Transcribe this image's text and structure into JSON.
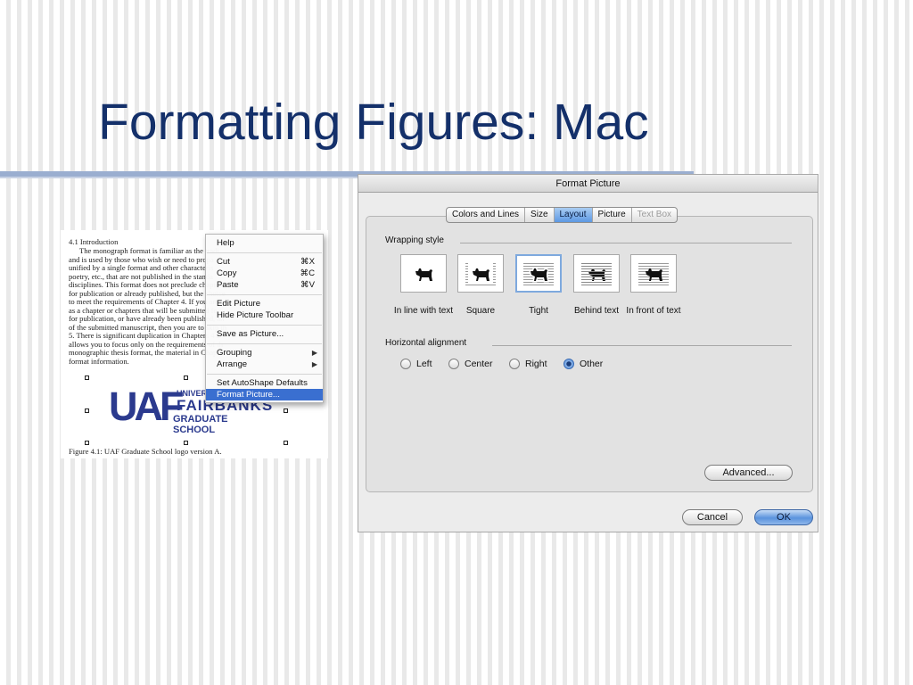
{
  "slide": {
    "title": "Formatting Figures: Mac"
  },
  "document": {
    "heading": "4.1    Introduction",
    "lines": [
      {
        "text": "The monograph format is familiar as the tradi",
        "indent": true
      },
      {
        "text": "and is used by those who wish or need to propa",
        "indent": false
      },
      {
        "text": "unified by a single format and other characteris",
        "indent": false
      },
      {
        "text": "poetry, etc., that are not published in the standa",
        "indent": false
      },
      {
        "text": "disciplines. This format does not preclude chapters",
        "indent": false
      },
      {
        "text": "for publication or already published, but the choice",
        "indent": false
      },
      {
        "text": "to meet the requirements of Chapter 4. If you are",
        "indent": false
      },
      {
        "text": "as a chapter or chapters that will be submitted fo",
        "indent": false
      },
      {
        "text": "for publication, or have already been published, an",
        "indent": false
      },
      {
        "text": "of the submitted manuscript, then you are to skip th",
        "indent": false
      },
      {
        "text": "5. There is significant duplication in Chapters 4 a",
        "indent": false
      },
      {
        "text": "allows you to focus only on the requirements of th",
        "indent": false
      },
      {
        "text": "monographic thesis format, the material in Chapter",
        "indent": false
      },
      {
        "text": "format information.",
        "indent": false
      }
    ],
    "logo": {
      "uaf": "UAF",
      "university": "UNIVERSITY",
      "fairbanks": "FAIRBANKS",
      "graduate_school": "GRADUATE SCHOOL"
    },
    "caption": "Figure 4.1: UAF Graduate School logo version A."
  },
  "context_menu": {
    "items": [
      {
        "label": "Help",
        "shortcut": "",
        "submenu": false
      },
      {
        "label": "Cut",
        "shortcut": "⌘X",
        "submenu": false
      },
      {
        "label": "Copy",
        "shortcut": "⌘C",
        "submenu": false
      },
      {
        "label": "Paste",
        "shortcut": "⌘V",
        "submenu": false
      },
      {
        "label": "Edit Picture",
        "shortcut": "",
        "submenu": false
      },
      {
        "label": "Hide Picture Toolbar",
        "shortcut": "",
        "submenu": false
      },
      {
        "label": "Save as Picture...",
        "shortcut": "",
        "submenu": false
      },
      {
        "label": "Grouping",
        "shortcut": "",
        "submenu": true
      },
      {
        "label": "Arrange",
        "shortcut": "",
        "submenu": true
      },
      {
        "label": "Set AutoShape Defaults",
        "shortcut": "",
        "submenu": false
      },
      {
        "label": "Format Picture...",
        "shortcut": "",
        "submenu": false,
        "highlighted": true
      }
    ]
  },
  "dialog": {
    "title": "Format Picture",
    "tabs": [
      {
        "label": "Colors and Lines",
        "state": "normal"
      },
      {
        "label": "Size",
        "state": "normal"
      },
      {
        "label": "Layout",
        "state": "active"
      },
      {
        "label": "Picture",
        "state": "normal"
      },
      {
        "label": "Text Box",
        "state": "disabled"
      }
    ],
    "wrapping_style": {
      "label": "Wrapping style",
      "selected": "Tight",
      "options": [
        {
          "label": "In line with text",
          "icon": "wrap-inline-icon"
        },
        {
          "label": "Square",
          "icon": "wrap-square-icon"
        },
        {
          "label": "Tight",
          "icon": "wrap-tight-icon"
        },
        {
          "label": "Behind text",
          "icon": "wrap-behind-icon"
        },
        {
          "label": "In front of text",
          "icon": "wrap-front-icon"
        }
      ]
    },
    "horizontal_alignment": {
      "label": "Horizontal alignment",
      "selected": "Other",
      "options": [
        "Left",
        "Center",
        "Right",
        "Other"
      ]
    },
    "buttons": {
      "advanced": "Advanced...",
      "cancel": "Cancel",
      "ok": "OK"
    }
  },
  "colors": {
    "title": "#14306a",
    "accent_blue": "#3a6fd0",
    "logo_blue": "#2b3a8e"
  }
}
